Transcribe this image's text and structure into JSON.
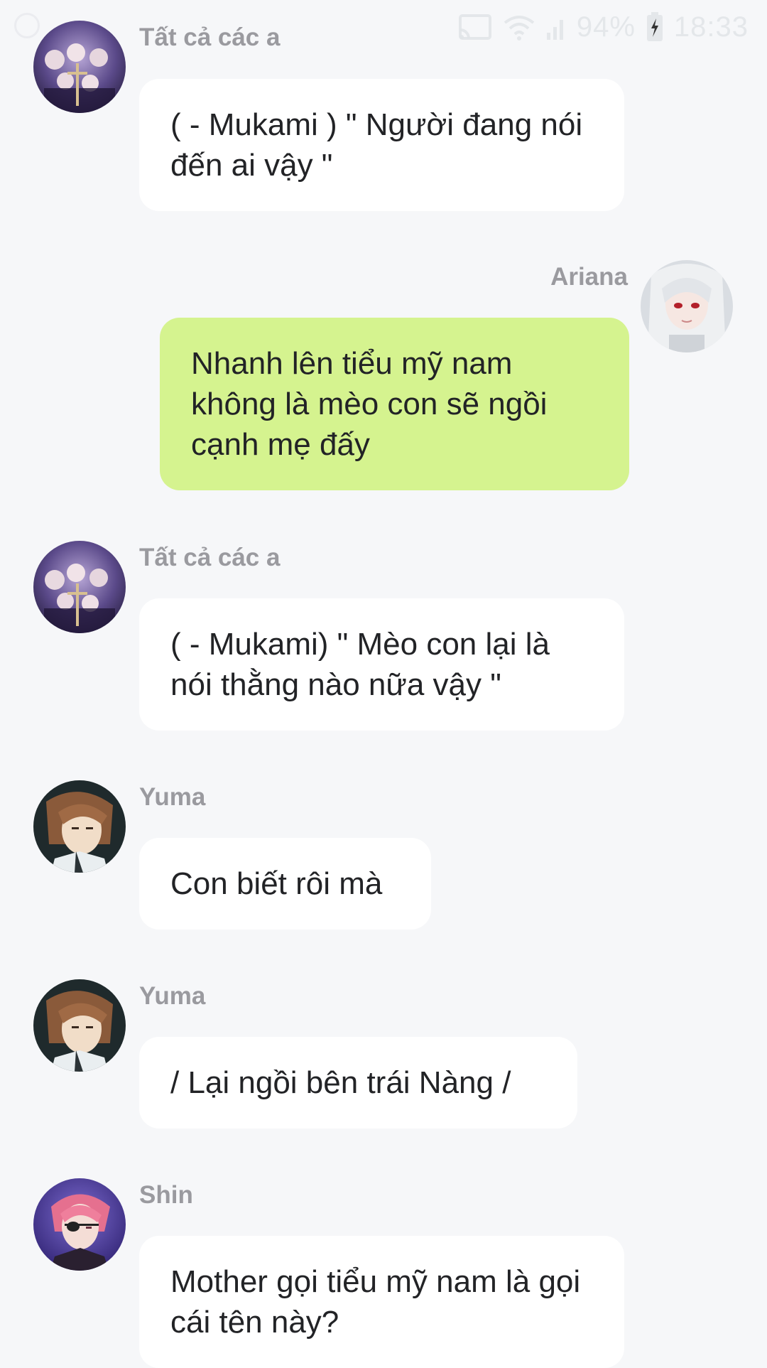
{
  "status_bar": {
    "battery_percent": "94%",
    "time": "18:33",
    "icons": [
      "messenger-icon",
      "cast-icon",
      "wifi-icon",
      "signal-icon",
      "battery-icon"
    ]
  },
  "colors": {
    "background": "#f6f7f9",
    "bubble_incoming": "#ffffff",
    "bubble_outgoing": "#d5f38f",
    "name_text": "#9a9a9f",
    "message_text": "#222326"
  },
  "messages": [
    {
      "sender": "Tất cả các a",
      "direction": "incoming",
      "avatar": "group-avatar",
      "text": "( - Mukami ) \" Người đang nói đến ai vậy \""
    },
    {
      "sender": "Ariana",
      "direction": "outgoing",
      "avatar": "ariana-avatar",
      "text": "Nhanh lên tiểu mỹ nam không là mèo con sẽ ngồi cạnh mẹ đấy"
    },
    {
      "sender": "Tất cả các a",
      "direction": "incoming",
      "avatar": "group-avatar",
      "text": "( - Mukami) \" Mèo con lại là nói thằng nào nữa vậy \""
    },
    {
      "sender": "Yuma",
      "direction": "incoming",
      "avatar": "yuma-avatar",
      "text": "Con biết rôi mà"
    },
    {
      "sender": "Yuma",
      "direction": "incoming",
      "avatar": "yuma-avatar",
      "text": "/ Lại ngồi bên trái Nàng /"
    },
    {
      "sender": "Shin",
      "direction": "incoming",
      "avatar": "shin-avatar",
      "text": "Mother gọi tiểu mỹ nam là gọi cái tên này?"
    }
  ]
}
